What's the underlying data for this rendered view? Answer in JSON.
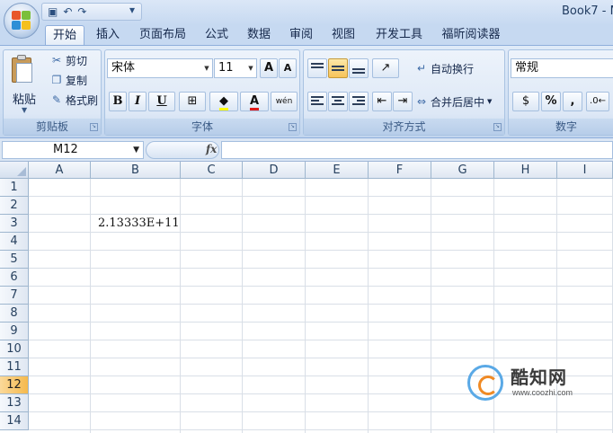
{
  "window": {
    "title": "Book7 - M"
  },
  "quick_access": {
    "save_icon": "save-icon",
    "undo_icon": "undo-icon",
    "redo_icon": "redo-icon",
    "more": "▾"
  },
  "tabs": [
    "开始",
    "插入",
    "页面布局",
    "公式",
    "数据",
    "审阅",
    "视图",
    "开发工具",
    "福昕阅读器"
  ],
  "ribbon": {
    "clipboard": {
      "paste": "粘贴",
      "cut": "剪切",
      "copy": "复制",
      "format_painter": "格式刷",
      "label": "剪贴板"
    },
    "font": {
      "font_name": "宋体",
      "font_size": "11",
      "bold": "B",
      "italic": "I",
      "underline": "U",
      "grow": "A",
      "shrink": "A",
      "font_color_letter": "A",
      "phonetic": "wén",
      "label": "字体"
    },
    "alignment": {
      "wrap_text": "自动换行",
      "merge_center": "合并后居中",
      "label": "对齐方式"
    },
    "number": {
      "format": "常规",
      "percent": "%",
      "comma": ",",
      "label": "数字"
    }
  },
  "formula_bar": {
    "name_box": "M12",
    "fx": "fx",
    "value": ""
  },
  "sheet": {
    "columns": [
      "A",
      "B",
      "C",
      "D",
      "E",
      "F",
      "G",
      "H",
      "I"
    ],
    "rows": [
      "1",
      "2",
      "3",
      "4",
      "5",
      "6",
      "7",
      "8",
      "9",
      "10",
      "11",
      "12",
      "13",
      "14"
    ],
    "selected_row": "12",
    "cells": {
      "B3": "2.13333E+11"
    }
  },
  "watermark": {
    "name": "酷知网",
    "url": "www.coozhi.com"
  },
  "colors": {
    "accent": "#f5b94c",
    "header_blue": "#c6d9f1"
  }
}
